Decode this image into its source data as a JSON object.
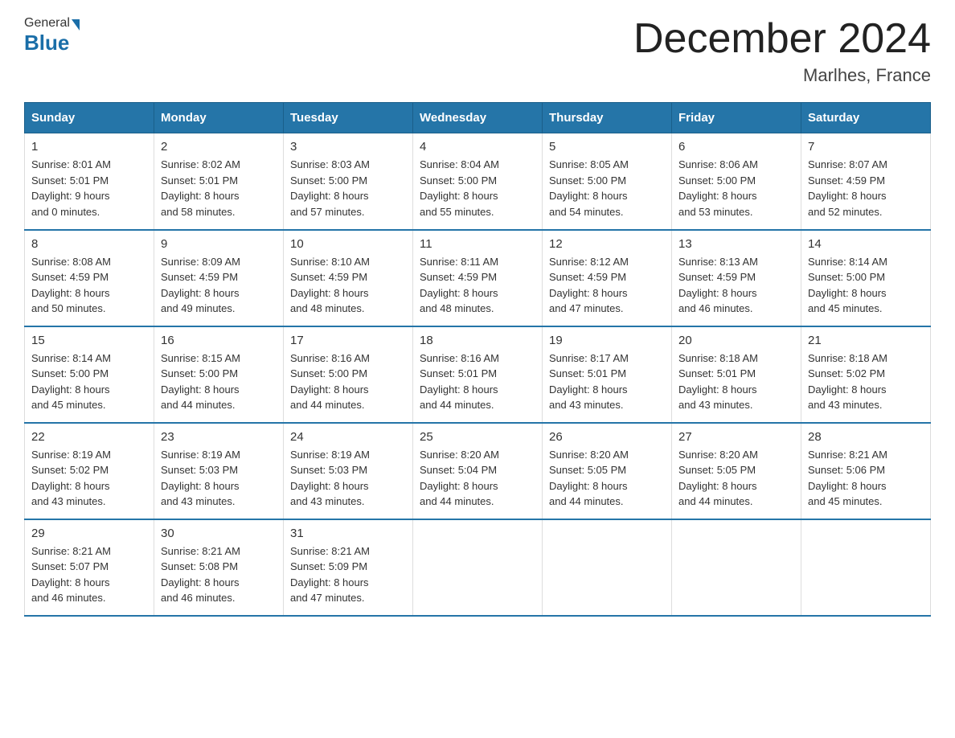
{
  "header": {
    "logo_general": "General",
    "logo_blue": "Blue",
    "title": "December 2024",
    "location": "Marlhes, France"
  },
  "weekdays": [
    "Sunday",
    "Monday",
    "Tuesday",
    "Wednesday",
    "Thursday",
    "Friday",
    "Saturday"
  ],
  "weeks": [
    [
      {
        "day": "1",
        "sunrise": "8:01 AM",
        "sunset": "5:01 PM",
        "daylight": "9 hours and 0 minutes."
      },
      {
        "day": "2",
        "sunrise": "8:02 AM",
        "sunset": "5:01 PM",
        "daylight": "8 hours and 58 minutes."
      },
      {
        "day": "3",
        "sunrise": "8:03 AM",
        "sunset": "5:00 PM",
        "daylight": "8 hours and 57 minutes."
      },
      {
        "day": "4",
        "sunrise": "8:04 AM",
        "sunset": "5:00 PM",
        "daylight": "8 hours and 55 minutes."
      },
      {
        "day": "5",
        "sunrise": "8:05 AM",
        "sunset": "5:00 PM",
        "daylight": "8 hours and 54 minutes."
      },
      {
        "day": "6",
        "sunrise": "8:06 AM",
        "sunset": "5:00 PM",
        "daylight": "8 hours and 53 minutes."
      },
      {
        "day": "7",
        "sunrise": "8:07 AM",
        "sunset": "4:59 PM",
        "daylight": "8 hours and 52 minutes."
      }
    ],
    [
      {
        "day": "8",
        "sunrise": "8:08 AM",
        "sunset": "4:59 PM",
        "daylight": "8 hours and 50 minutes."
      },
      {
        "day": "9",
        "sunrise": "8:09 AM",
        "sunset": "4:59 PM",
        "daylight": "8 hours and 49 minutes."
      },
      {
        "day": "10",
        "sunrise": "8:10 AM",
        "sunset": "4:59 PM",
        "daylight": "8 hours and 48 minutes."
      },
      {
        "day": "11",
        "sunrise": "8:11 AM",
        "sunset": "4:59 PM",
        "daylight": "8 hours and 48 minutes."
      },
      {
        "day": "12",
        "sunrise": "8:12 AM",
        "sunset": "4:59 PM",
        "daylight": "8 hours and 47 minutes."
      },
      {
        "day": "13",
        "sunrise": "8:13 AM",
        "sunset": "4:59 PM",
        "daylight": "8 hours and 46 minutes."
      },
      {
        "day": "14",
        "sunrise": "8:14 AM",
        "sunset": "5:00 PM",
        "daylight": "8 hours and 45 minutes."
      }
    ],
    [
      {
        "day": "15",
        "sunrise": "8:14 AM",
        "sunset": "5:00 PM",
        "daylight": "8 hours and 45 minutes."
      },
      {
        "day": "16",
        "sunrise": "8:15 AM",
        "sunset": "5:00 PM",
        "daylight": "8 hours and 44 minutes."
      },
      {
        "day": "17",
        "sunrise": "8:16 AM",
        "sunset": "5:00 PM",
        "daylight": "8 hours and 44 minutes."
      },
      {
        "day": "18",
        "sunrise": "8:16 AM",
        "sunset": "5:01 PM",
        "daylight": "8 hours and 44 minutes."
      },
      {
        "day": "19",
        "sunrise": "8:17 AM",
        "sunset": "5:01 PM",
        "daylight": "8 hours and 43 minutes."
      },
      {
        "day": "20",
        "sunrise": "8:18 AM",
        "sunset": "5:01 PM",
        "daylight": "8 hours and 43 minutes."
      },
      {
        "day": "21",
        "sunrise": "8:18 AM",
        "sunset": "5:02 PM",
        "daylight": "8 hours and 43 minutes."
      }
    ],
    [
      {
        "day": "22",
        "sunrise": "8:19 AM",
        "sunset": "5:02 PM",
        "daylight": "8 hours and 43 minutes."
      },
      {
        "day": "23",
        "sunrise": "8:19 AM",
        "sunset": "5:03 PM",
        "daylight": "8 hours and 43 minutes."
      },
      {
        "day": "24",
        "sunrise": "8:19 AM",
        "sunset": "5:03 PM",
        "daylight": "8 hours and 43 minutes."
      },
      {
        "day": "25",
        "sunrise": "8:20 AM",
        "sunset": "5:04 PM",
        "daylight": "8 hours and 44 minutes."
      },
      {
        "day": "26",
        "sunrise": "8:20 AM",
        "sunset": "5:05 PM",
        "daylight": "8 hours and 44 minutes."
      },
      {
        "day": "27",
        "sunrise": "8:20 AM",
        "sunset": "5:05 PM",
        "daylight": "8 hours and 44 minutes."
      },
      {
        "day": "28",
        "sunrise": "8:21 AM",
        "sunset": "5:06 PM",
        "daylight": "8 hours and 45 minutes."
      }
    ],
    [
      {
        "day": "29",
        "sunrise": "8:21 AM",
        "sunset": "5:07 PM",
        "daylight": "8 hours and 46 minutes."
      },
      {
        "day": "30",
        "sunrise": "8:21 AM",
        "sunset": "5:08 PM",
        "daylight": "8 hours and 46 minutes."
      },
      {
        "day": "31",
        "sunrise": "8:21 AM",
        "sunset": "5:09 PM",
        "daylight": "8 hours and 47 minutes."
      },
      null,
      null,
      null,
      null
    ]
  ]
}
